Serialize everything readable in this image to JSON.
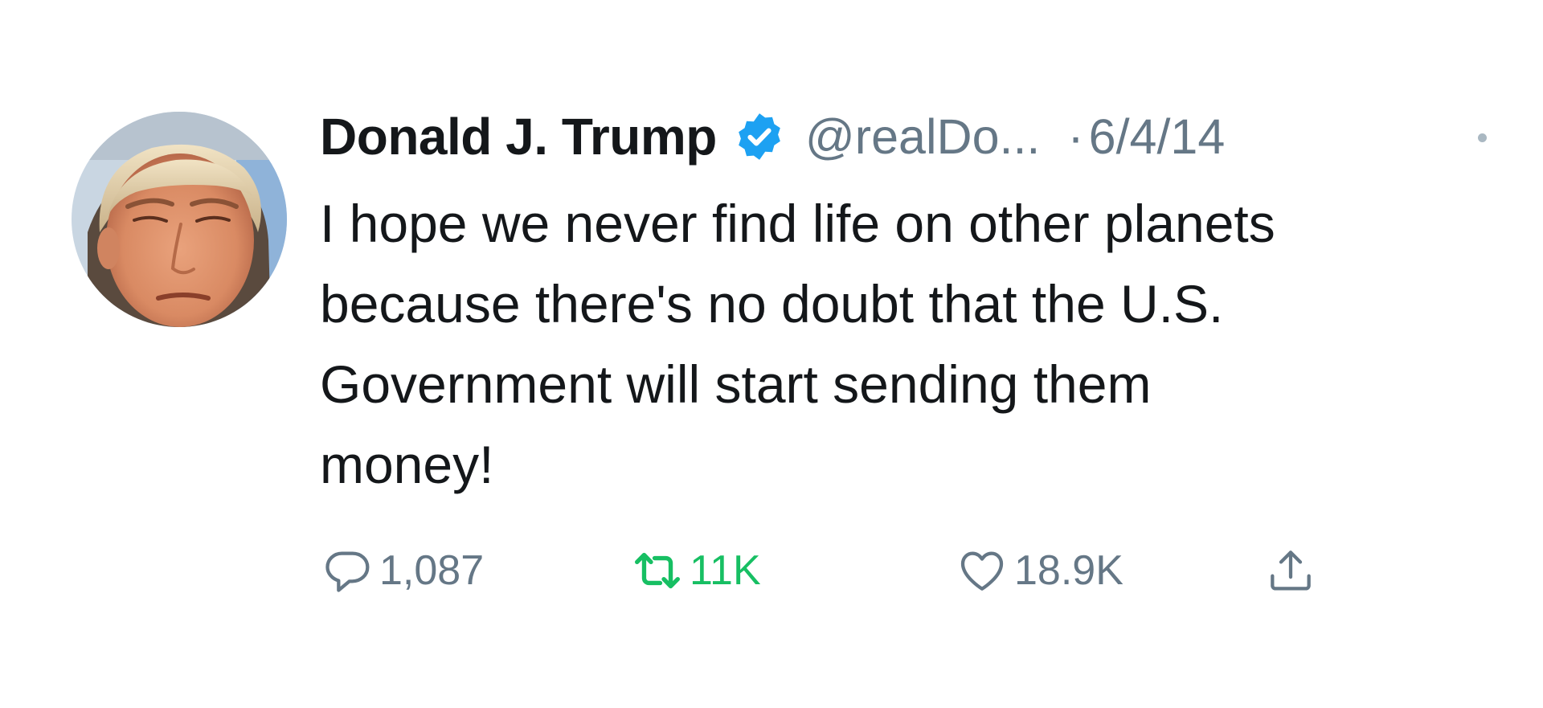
{
  "user": {
    "display_name": "Donald J. Trump",
    "handle": "@realDo...",
    "verified": true
  },
  "tweet": {
    "separator": "·",
    "date": "6/4/14",
    "lines": [
      "I hope we never find life on other planets",
      "because there's no doubt that the U.S.",
      "Government will start sending them",
      "money!"
    ]
  },
  "actions": {
    "reply_count": "1,087",
    "retweet_count": "11K",
    "like_count": "18.9K"
  },
  "icons": {
    "avatar": "profile-photo",
    "verified": "verified-badge-icon",
    "reply": "reply-bubble-icon",
    "retweet": "retweet-arrows-icon",
    "like": "heart-icon",
    "share": "share-upload-icon",
    "more": "more-dot-icon"
  },
  "colors": {
    "text": "#14171a",
    "secondary": "#657786",
    "verified_blue": "#1da1f2",
    "retweet_green": "#17bf63"
  }
}
